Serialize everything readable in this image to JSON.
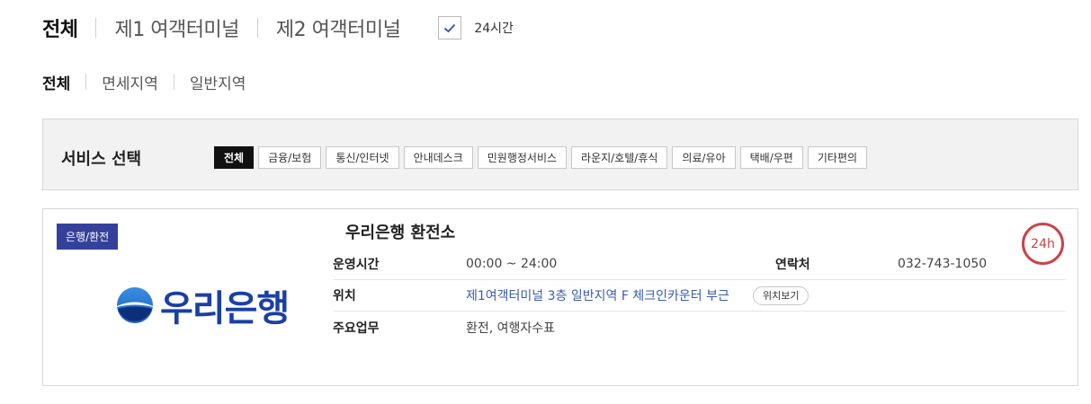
{
  "terminal_tabs": [
    {
      "label": "전체",
      "active": true
    },
    {
      "label": "제1 여객터미널",
      "active": false
    },
    {
      "label": "제2 여객터미널",
      "active": false
    }
  ],
  "open_24h_filter": {
    "label": "24시간",
    "checked": true
  },
  "zone_tabs": [
    {
      "label": "전체",
      "active": true
    },
    {
      "label": "면세지역",
      "active": false
    },
    {
      "label": "일반지역",
      "active": false
    }
  ],
  "service_filter": {
    "title": "서비스 선택",
    "chips": [
      {
        "label": "전체",
        "active": true
      },
      {
        "label": "금융/보험",
        "active": false
      },
      {
        "label": "통신/인터넷",
        "active": false
      },
      {
        "label": "안내데스크",
        "active": false
      },
      {
        "label": "민원행정서비스",
        "active": false
      },
      {
        "label": "라운지/호텔/휴식",
        "active": false
      },
      {
        "label": "의료/유아",
        "active": false
      },
      {
        "label": "택배/우편",
        "active": false
      },
      {
        "label": "기타편의",
        "active": false
      }
    ]
  },
  "result_card": {
    "category": "은행/환전",
    "logo_text": "우리은행",
    "name": "우리은행 환전소",
    "hours_label": "운영시간",
    "hours": "00:00 ~ 24:00",
    "contact_label": "연락처",
    "contact": "032-743-1050",
    "location_label": "위치",
    "location": "제1여객터미널 3층 일반지역 F 체크인카운터 부근",
    "map_button": "위치보기",
    "services_label": "주요업무",
    "services": "환전, 여행자수표",
    "badge_24h": "24h"
  },
  "colors": {
    "badge_bg": "#34419b",
    "logo_blue": "#1a3fa6",
    "link_blue": "#3a5da8",
    "h24_red": "#c9434a",
    "filter_bg": "#f2f2f2"
  }
}
